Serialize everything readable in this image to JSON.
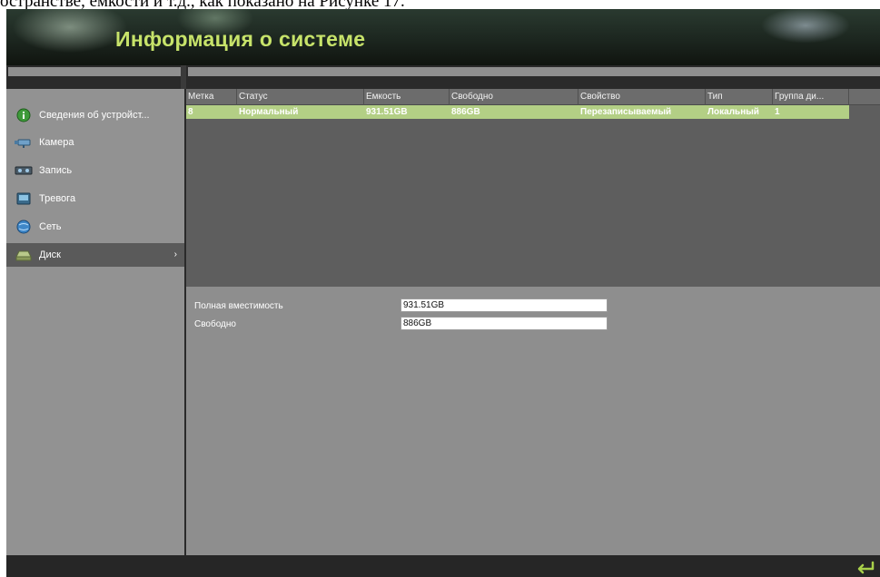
{
  "caption": "остранстве, емкости и т.д., как показано на Рисунке 17.",
  "header": {
    "title": "Информация о системе"
  },
  "sidebar": {
    "items": [
      {
        "label": "Сведения об устройст...",
        "icon": "info-icon",
        "active": false
      },
      {
        "label": "Камера",
        "icon": "camera-icon",
        "active": false
      },
      {
        "label": "Запись",
        "icon": "record-icon",
        "active": false
      },
      {
        "label": "Тревога",
        "icon": "alarm-icon",
        "active": false
      },
      {
        "label": "Сеть",
        "icon": "network-icon",
        "active": false
      },
      {
        "label": "Диск",
        "icon": "disk-icon",
        "active": true,
        "arrow": "›"
      }
    ]
  },
  "table": {
    "columns": [
      "Метка",
      "Статус",
      "Емкость",
      "Свободно",
      "Свойство",
      "Тип",
      "Группа ди..."
    ],
    "rows": [
      [
        "8",
        "Нормальный",
        "931.51GB",
        "886GB",
        "Перезаписываемый",
        "Локальный",
        "1"
      ]
    ]
  },
  "info": {
    "total_label": "Полная вместимость",
    "total_value": "931.51GB",
    "free_label": "Свободно",
    "free_value": "886GB"
  },
  "colors": {
    "title": "#c7e36a",
    "row_highlight": "#b3cf85",
    "sidebar_active": "#5a5a5a"
  }
}
